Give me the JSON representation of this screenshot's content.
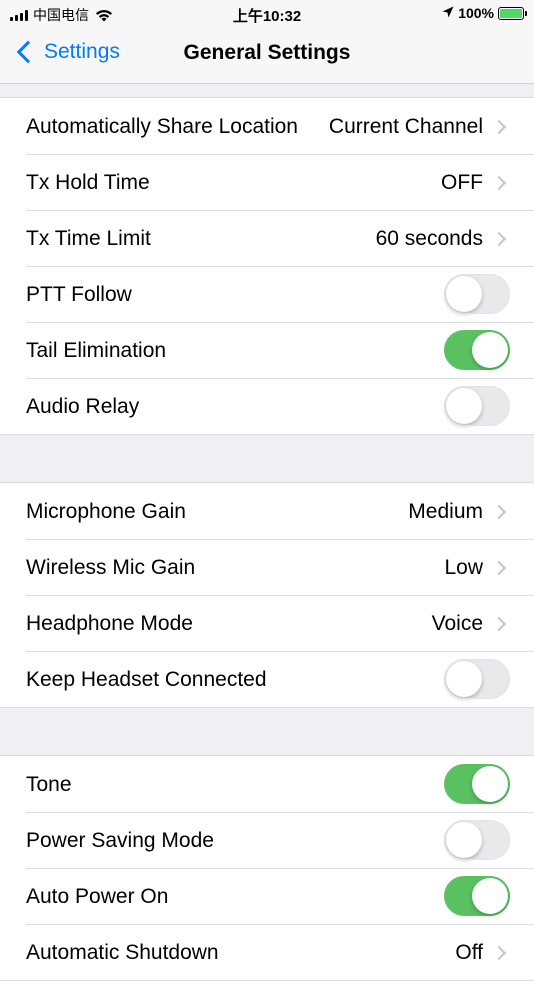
{
  "status_bar": {
    "carrier": "中国电信",
    "time": "上午10:32",
    "battery": "100%",
    "battery_level": 1.0
  },
  "nav": {
    "back_label": "Settings",
    "title": "General Settings"
  },
  "groups": [
    {
      "rows": [
        {
          "label": "Automatically Share Location",
          "value": "Current Channel",
          "type": "disclosure"
        },
        {
          "label": "Tx Hold Time",
          "value": "OFF",
          "type": "disclosure"
        },
        {
          "label": "Tx Time Limit",
          "value": "60 seconds",
          "type": "disclosure"
        },
        {
          "label": "PTT Follow",
          "type": "toggle",
          "on": false
        },
        {
          "label": "Tail Elimination",
          "type": "toggle",
          "on": true
        },
        {
          "label": "Audio Relay",
          "type": "toggle",
          "on": false
        }
      ]
    },
    {
      "rows": [
        {
          "label": "Microphone Gain",
          "value": "Medium",
          "type": "disclosure"
        },
        {
          "label": "Wireless Mic Gain",
          "value": "Low",
          "type": "disclosure"
        },
        {
          "label": "Headphone Mode",
          "value": "Voice",
          "type": "disclosure"
        },
        {
          "label": "Keep Headset Connected",
          "type": "toggle",
          "on": false
        }
      ]
    },
    {
      "rows": [
        {
          "label": "Tone",
          "type": "toggle",
          "on": true
        },
        {
          "label": "Power Saving Mode",
          "type": "toggle",
          "on": false
        },
        {
          "label": "Auto Power On",
          "type": "toggle",
          "on": true
        },
        {
          "label": "Automatic Shutdown",
          "value": "Off",
          "type": "disclosure"
        }
      ]
    }
  ],
  "colors": {
    "accent": "#007aff",
    "toggle_on": "#5ac161",
    "toggle_off": "#e9e9eb",
    "background": "#efeff4"
  }
}
